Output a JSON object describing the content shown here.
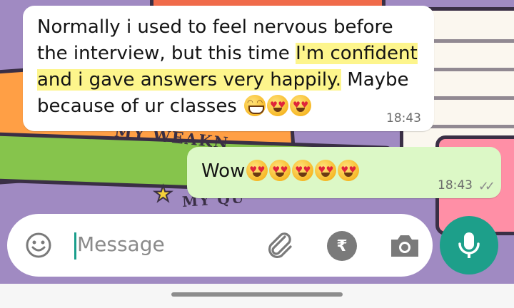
{
  "chat": {
    "incoming": {
      "text_part1": "Normally i used to feel nervous before the interview, but this time ",
      "text_highlight": "I'm confident and i gave answers very happily.",
      "text_part2": " Maybe because of ur classes",
      "emojis": [
        "grinning-face-emoji",
        "heart-eyes-emoji",
        "heart-eyes-emoji"
      ],
      "time": "18:43"
    },
    "outgoing": {
      "text": "Wow",
      "emojis": [
        "heart-eyes-emoji",
        "heart-eyes-emoji",
        "heart-eyes-emoji",
        "heart-eyes-emoji",
        "heart-eyes-emoji"
      ],
      "time": "18:43",
      "status": "read"
    }
  },
  "input": {
    "placeholder": "Message"
  },
  "colors": {
    "wallpaper": "#a08ac2",
    "outgoing_bubble": "#dcf8c6",
    "accent": "#1d9f8a",
    "highlight": "#fdf58c"
  }
}
